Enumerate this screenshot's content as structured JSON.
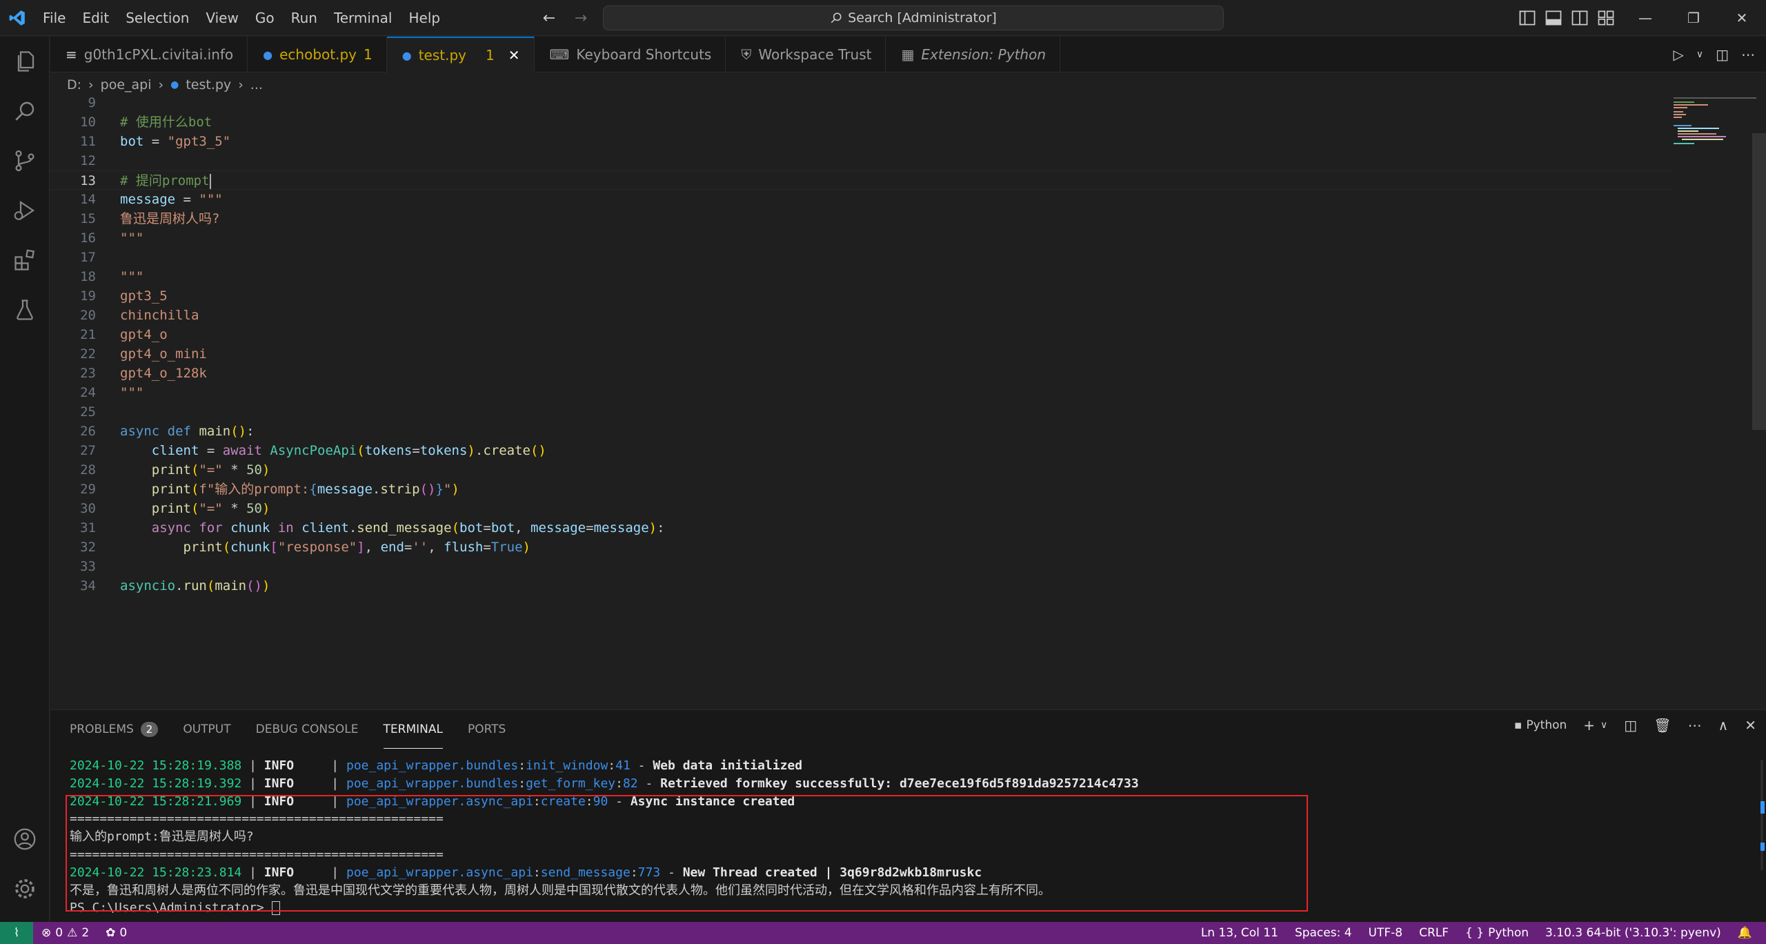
{
  "titlebar": {
    "menu": [
      "File",
      "Edit",
      "Selection",
      "View",
      "Go",
      "Run",
      "Terminal",
      "Help"
    ],
    "search_text": "Search [Administrator]"
  },
  "tabs": [
    {
      "label": "g0th1cPXL.civitai.info",
      "badge": "",
      "icon": "lines-icon"
    },
    {
      "label": "echobot.py",
      "badge": "1",
      "icon": "python-icon"
    },
    {
      "label": "test.py",
      "badge": "1",
      "icon": "python-icon"
    },
    {
      "label": "Keyboard Shortcuts",
      "badge": "",
      "icon": "keyboard-icon"
    },
    {
      "label": "Workspace Trust",
      "badge": "",
      "icon": "shield-icon"
    },
    {
      "label": "Extension: Python",
      "badge": "",
      "icon": "extensions-icon"
    }
  ],
  "breadcrumb": {
    "drive": "D:",
    "folder": "poe_api",
    "file": "test.py",
    "more": "..."
  },
  "code": {
    "ln9": "9",
    "ln10": "10",
    "ln11": "11",
    "ln12": "12",
    "ln13": "13",
    "ln14": "14",
    "ln15": "15",
    "ln16": "16",
    "ln17": "17",
    "ln18": "18",
    "ln19": "19",
    "ln20": "20",
    "ln21": "21",
    "ln22": "22",
    "ln23": "23",
    "ln24": "24",
    "ln25": "25",
    "ln26": "26",
    "ln27": "27",
    "ln28": "28",
    "ln29": "29",
    "ln30": "30",
    "ln31": "31",
    "ln32": "32",
    "ln33": "33",
    "ln34": "34",
    "c10": "# 使用什么bot",
    "c13": "# 提问prompt",
    "bot_var": "bot",
    "bot_val": "\"gpt3_5\"",
    "msg_var": "message",
    "triple": "\"\"\"",
    "msg_text": "鲁迅是周树人吗?",
    "m19": "gpt3_5",
    "m20": "chinchilla",
    "m21": "gpt4_o",
    "m22": "gpt4_o_mini",
    "m23": "gpt4_o_128k",
    "async": "async",
    "def": "def",
    "main": "main",
    "client": "client",
    "await": "await",
    "cls": "AsyncPoeApi",
    "tokens": "tokens",
    "create": "create",
    "print": "print",
    "eq_str": "\"=\"",
    "fifty": "50",
    "fprefix": "f\"输入的prompt:",
    "strip": "strip",
    "for": "for",
    "in": "in",
    "chunk": "chunk",
    "send_message": "send_message",
    "resp": "\"response\"",
    "end": "end",
    "empty": "''",
    "flush": "flush",
    "true": "True",
    "asyncio": "asyncio",
    "run": "run"
  },
  "panel": {
    "tabs": [
      "PROBLEMS",
      "OUTPUT",
      "DEBUG CONSOLE",
      "TERMINAL",
      "PORTS"
    ],
    "problems_count": "2",
    "shell": "Python",
    "lines": {
      "l1_date": "2024-10-22 15:28:19.388",
      "l1_lvl": "INFO",
      "l1_mod": "poe_api_wrapper.bundles",
      "l1_fn": "init_window",
      "l1_no": "41",
      "l1_msg": "Web data initialized",
      "l2_date": "2024-10-22 15:28:19.392",
      "l2_lvl": "INFO",
      "l2_mod": "poe_api_wrapper.bundles",
      "l2_fn": "get_form_key",
      "l2_no": "82",
      "l2_msg": "Retrieved formkey successfully: d7ee7ece19f6d5f891da9257214c4733",
      "l3_date": "2024-10-22 15:28:21.969",
      "l3_lvl": "INFO",
      "l3_mod": "poe_api_wrapper.async_api",
      "l3_fn": "create",
      "l3_no": "90",
      "l3_msg": "Async instance created",
      "sep": "==================================================",
      "prompt_line": "输入的prompt:鲁迅是周树人吗?",
      "l6_date": "2024-10-22 15:28:23.814",
      "l6_lvl": "INFO",
      "l6_mod": "poe_api_wrapper.async_api",
      "l6_fn": "send_message",
      "l6_no": "773",
      "l6_msg": "New Thread created | 3q69r8d2wkb18mruskc",
      "answer": "不是，鲁迅和周树人是两位不同的作家。鲁迅是中国现代文学的重要代表人物，周树人则是中国现代散文的代表人物。他们虽然同时代活动，但在文学风格和作品内容上有所不同。",
      "ps_prompt": "PS C:\\Users\\Administrator> "
    }
  },
  "statusbar": {
    "errors": "0",
    "warnings": "2",
    "ports": "0",
    "position": "Ln 13, Col 11",
    "spaces": "Spaces: 4",
    "encoding": "UTF-8",
    "eol": "CRLF",
    "language": "Python",
    "interpreter": "3.10.3 64-bit ('3.10.3': pyenv)"
  },
  "colors": {
    "accent": "#0078d4",
    "statusbar": "#68217a",
    "highlight_box": "#e8242a"
  }
}
